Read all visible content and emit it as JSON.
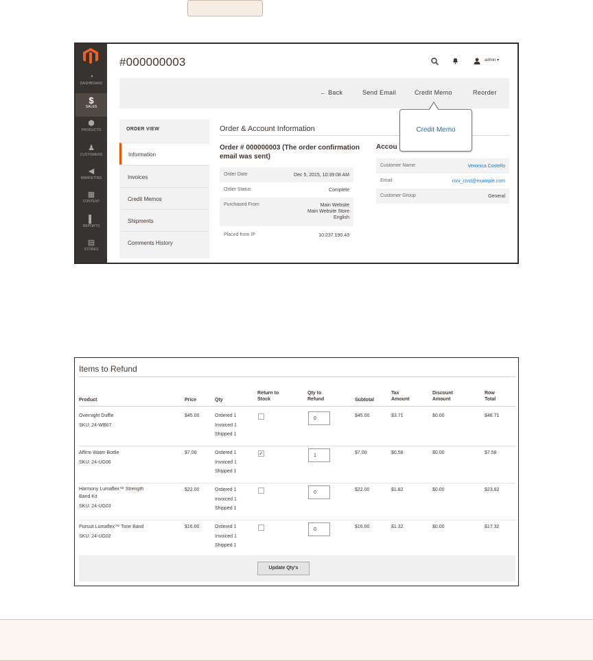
{
  "header": {
    "title": "#000000003",
    "user": "admin"
  },
  "sidebar": {
    "items": [
      {
        "label": "DASHBOARD",
        "icon": "dashboard-icon",
        "glyph": "◔"
      },
      {
        "label": "SALES",
        "icon": "dollar-icon",
        "glyph": "$"
      },
      {
        "label": "PRODUCTS",
        "icon": "cube-icon",
        "glyph": "⬢"
      },
      {
        "label": "CUSTOMERS",
        "icon": "person-icon",
        "glyph": "♟"
      },
      {
        "label": "MARKETING",
        "icon": "megaphone-icon",
        "glyph": "◀"
      },
      {
        "label": "CONTENT",
        "icon": "content-icon",
        "glyph": "▦"
      },
      {
        "label": "REPORTS",
        "icon": "bar-chart-icon",
        "glyph": "▌"
      },
      {
        "label": "STORES",
        "icon": "store-icon",
        "glyph": "▤"
      }
    ]
  },
  "actions": {
    "back": "← Back",
    "send_email": "Send Email",
    "credit_memo": "Credit Memo",
    "reorder": "Reorder"
  },
  "callout": {
    "text": "Credit Memo"
  },
  "order_view": {
    "heading": "ORDER VIEW",
    "items": [
      "Information",
      "Invoices",
      "Credit Memos",
      "Shipments",
      "Comments History"
    ]
  },
  "order_info": {
    "section_title": "Order & Account Information",
    "order_heading": "Order # 000000003 (The order confirmation email was sent)",
    "rows": [
      {
        "label": "Order Date",
        "value": "Dec 5, 2015, 10:39:08 AM"
      },
      {
        "label": "Order Status",
        "value": "Complete"
      },
      {
        "label": "Purchased From",
        "value": "Main Website\nMain Website Store\nEnglish"
      },
      {
        "label": "Placed from IP",
        "value": "10.237.190.43"
      }
    ]
  },
  "account_info": {
    "heading": "Accou",
    "rows": [
      {
        "label": "Customer Name",
        "value": "Veronica Costello"
      },
      {
        "label": "Email",
        "value": "roni_cost@example.com"
      },
      {
        "label": "Customer Group",
        "value": "General"
      }
    ]
  },
  "refund": {
    "title": "Items to Refund",
    "headers": {
      "product": "Product",
      "price": "Price",
      "qty": "Qty",
      "return_to_stock": "Return to\nStock",
      "qty_to_refund": "Qty to\nRefund",
      "subtotal": "Subtotal",
      "tax_amount": "Tax\nAmount",
      "discount_amount": "Discount\nAmount",
      "row_total": "Row\nTotal"
    },
    "rows": [
      {
        "product": "Overnight Duffle",
        "sku": "SKU: 24-WB07",
        "price": "$45.00",
        "qty": "Ordered 1\nInvoiced 1\nShipped 1",
        "return_to_stock": false,
        "qty_to_refund": "0",
        "subtotal": "$45.00",
        "tax": "$3.71",
        "discount": "$0.00",
        "row_total": "$48.71"
      },
      {
        "product": "Affirm Water Bottle",
        "sku": "SKU: 24-UG06",
        "price": "$7.00",
        "qty": "Ordered 1\nInvoiced 1\nShipped 1",
        "return_to_stock": true,
        "qty_to_refund": "1",
        "subtotal": "$7.00",
        "tax": "$0.58",
        "discount": "$0.00",
        "row_total": "$7.58"
      },
      {
        "product": "Harmony Lumaflex™ Strength\nBand Kit",
        "sku": "SKU: 24-UG03",
        "price": "$22.00",
        "qty": "Ordered 1\nInvoiced 1\nShipped 1",
        "return_to_stock": false,
        "qty_to_refund": "0",
        "subtotal": "$22.00",
        "tax": "$1.82",
        "discount": "$0.00",
        "row_total": "$23.82"
      },
      {
        "product": "Pursuit Lumaflex™ Tone Band",
        "sku": "SKU: 24-UG02",
        "price": "$16.00",
        "qty": "Ordered 1\nInvoiced 1\nShipped 1",
        "return_to_stock": false,
        "qty_to_refund": "0",
        "subtotal": "$16.00",
        "tax": "$1.32",
        "discount": "$0.00",
        "row_total": "$17.32"
      }
    ],
    "update_button": "Update Qty's"
  },
  "colors": {
    "accent": "#eb5202",
    "link": "#1979c3",
    "sidebar": "#373330"
  }
}
